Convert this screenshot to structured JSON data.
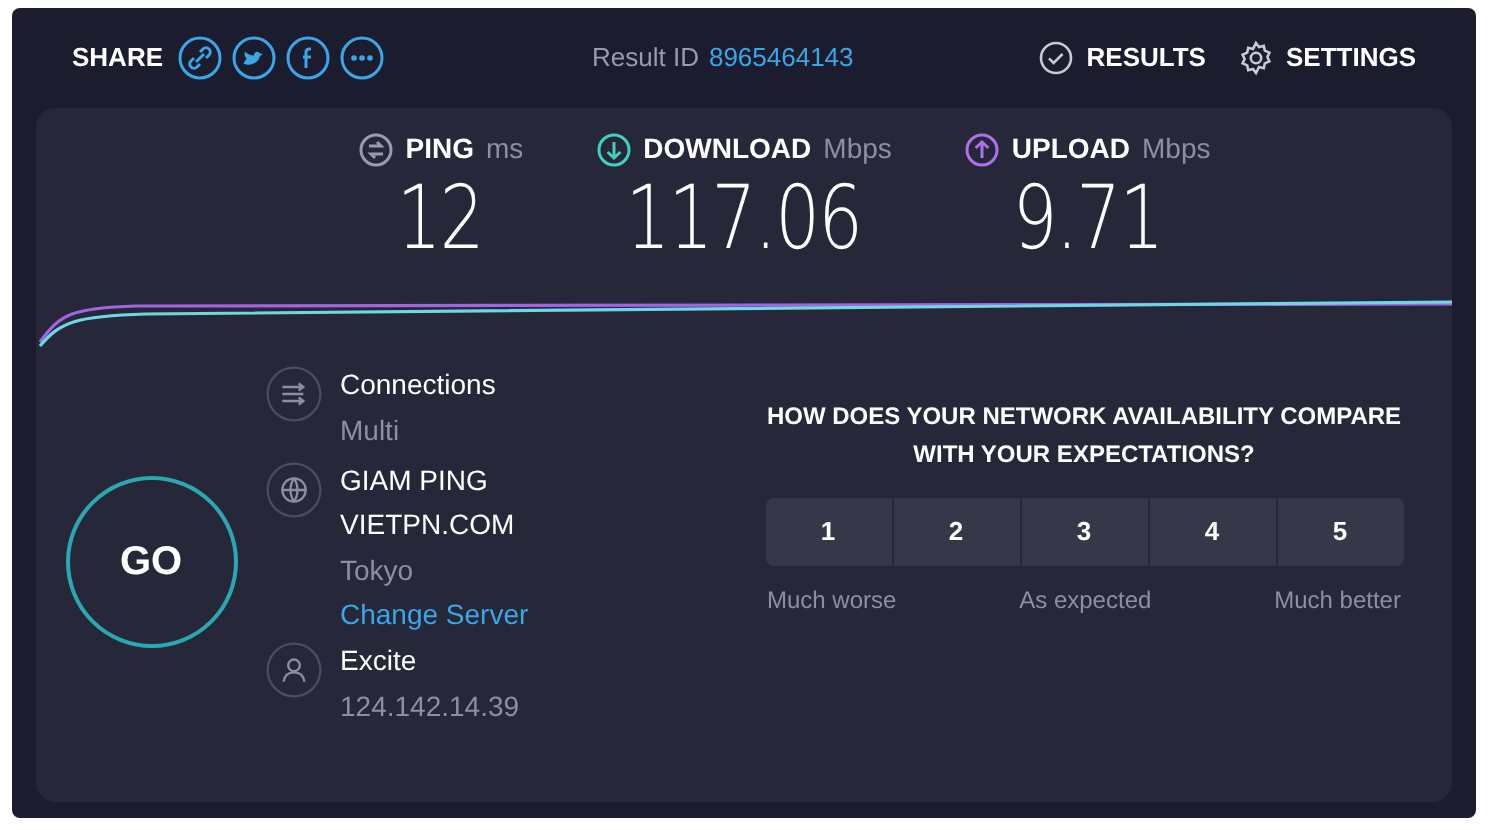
{
  "header": {
    "share_label": "SHARE",
    "result_id_label": "Result ID",
    "result_id": "8965464143",
    "nav": [
      {
        "kind": "results",
        "label": "RESULTS"
      },
      {
        "kind": "settings",
        "label": "SETTINGS"
      }
    ]
  },
  "metrics": [
    {
      "kind": "ping",
      "label": "PING",
      "unit": "ms",
      "value": "12"
    },
    {
      "kind": "download",
      "label": "DOWNLOAD",
      "unit": "Mbps",
      "value": "117.06"
    },
    {
      "kind": "upload",
      "label": "UPLOAD",
      "unit": "Mbps",
      "value": "9.71"
    }
  ],
  "go_button": "GO",
  "info": [
    {
      "kind": "connections",
      "lines": [
        "Connections"
      ],
      "detail": "Multi"
    },
    {
      "kind": "server",
      "lines": [
        "GIAM PING",
        "VIETPN.COM"
      ],
      "detail": "Tokyo",
      "link": "Change Server"
    },
    {
      "kind": "provider",
      "lines": [
        "Excite"
      ],
      "detail": "124.142.14.39"
    }
  ],
  "survey": {
    "question": "HOW DOES YOUR NETWORK AVAILABILITY COMPARE WITH YOUR EXPECTATIONS?",
    "options": [
      "1",
      "2",
      "3",
      "4",
      "5"
    ],
    "scale_labels": [
      "Much worse",
      "As expected",
      "Much better"
    ]
  }
}
